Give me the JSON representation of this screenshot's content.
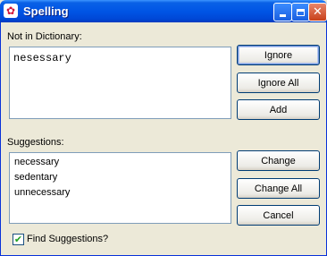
{
  "window": {
    "title": "Spelling",
    "app_icon": "spellcheck-icon",
    "controls": {
      "minimize": "minimize-icon",
      "maximize": "maximize-icon",
      "close": "close-icon"
    }
  },
  "not_in_dictionary": {
    "label": "Not in Dictionary:",
    "word": "nesessary"
  },
  "suggestions": {
    "label": "Suggestions:",
    "items": [
      "necessary",
      "sedentary",
      "unnecessary"
    ]
  },
  "buttons": {
    "ignore": "Ignore",
    "ignore_all": "Ignore All",
    "add": "Add",
    "change": "Change",
    "change_all": "Change All",
    "cancel": "Cancel"
  },
  "find_suggestions": {
    "label": "Find Suggestions?",
    "checked": true
  },
  "colors": {
    "titlebar": "#0055e5",
    "dialog_bg": "#ece9d8",
    "checkmark": "#21a121"
  }
}
